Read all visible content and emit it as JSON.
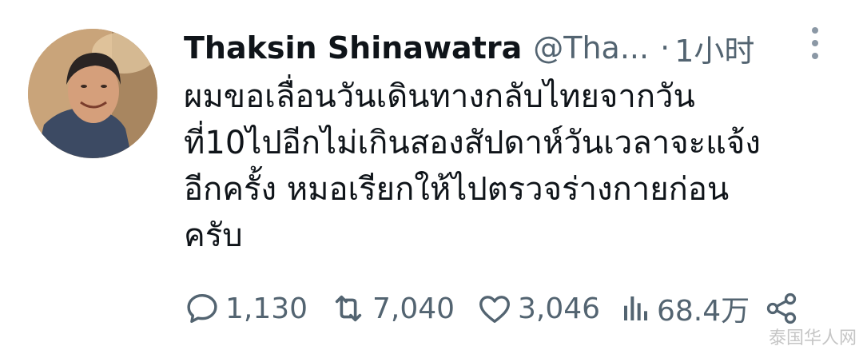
{
  "author": {
    "display_name": "Thaksin Shinawatra",
    "handle": "@Tha...",
    "separator": "·",
    "timestamp": "1小时"
  },
  "tweet": {
    "lines": [
      "ผมขอเลื่อนวันเดินทางกลับไทยจากวัน",
      "ที่10ไปอีกไม่เกินสองสัปดาห์วันเวลาจะแจ้ง",
      "อีกครั้ง หมอเรียกให้ไปตรวจร่างกายก่อน",
      "ครับ"
    ]
  },
  "actions": {
    "replies": "1,130",
    "retweets": "7,040",
    "likes": "3,046",
    "views": "68.4万"
  },
  "icons": {
    "reply": "speech-bubble-icon",
    "retweet": "retweet-arrows-icon",
    "like": "heart-icon",
    "views": "bar-chart-icon",
    "share": "share-nodes-icon",
    "more": "vertical-dots-icon"
  },
  "watermark": "泰国华人网",
  "colors": {
    "text": "#0f1419",
    "secondary": "#536471"
  }
}
